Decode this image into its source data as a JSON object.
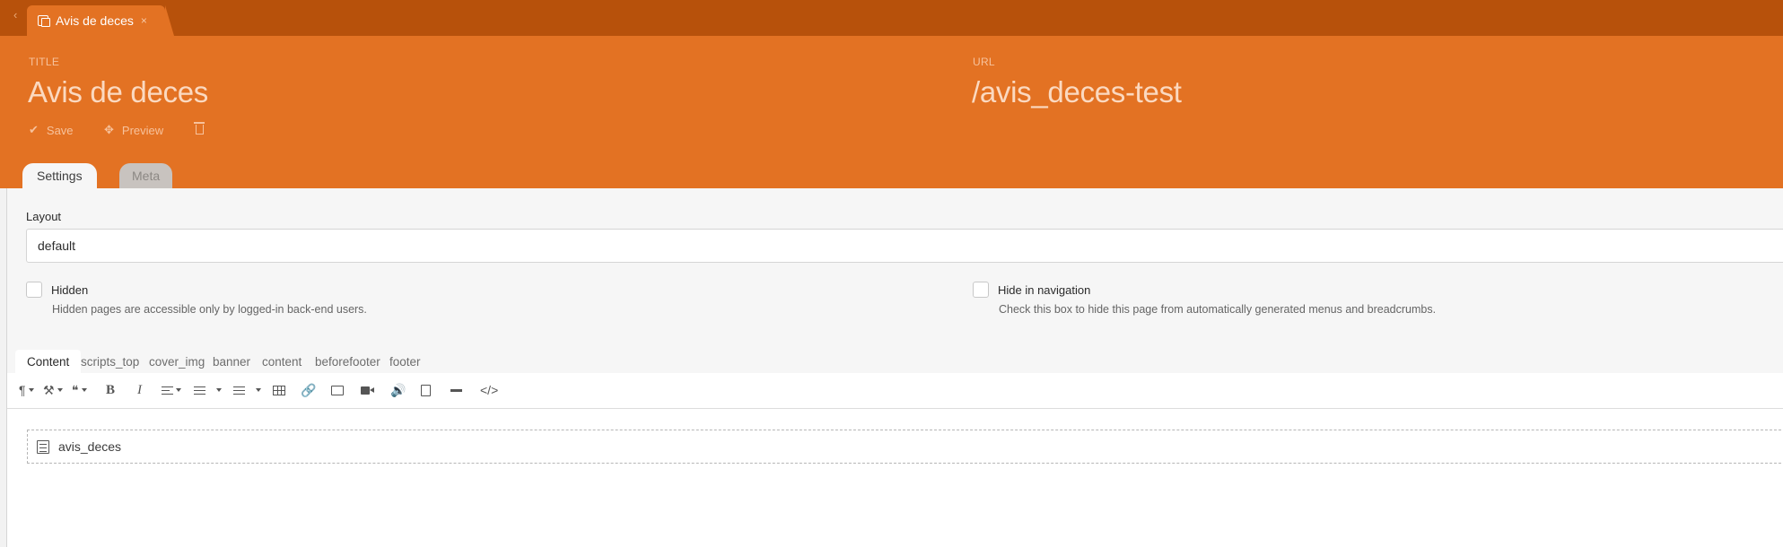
{
  "tab": {
    "title": "Avis de deces",
    "close": "×",
    "back": "‹"
  },
  "header": {
    "title_label": "TITLE",
    "title_value": "Avis de deces",
    "url_label": "URL",
    "url_value": "/avis_deces-test"
  },
  "actions": {
    "save": "Save",
    "preview": "Preview"
  },
  "form_tabs": {
    "settings": "Settings",
    "meta": "Meta"
  },
  "layout": {
    "label": "Layout",
    "value": "default"
  },
  "checkboxes": {
    "hidden": {
      "label": "Hidden",
      "help": "Hidden pages are accessible only by logged-in back-end users.",
      "checked": false
    },
    "hide_nav": {
      "label": "Hide in navigation",
      "help": "Check this box to hide this page from automatically generated menus and breadcrumbs.",
      "checked": false
    }
  },
  "content_tabs": [
    "Content",
    "scripts_top",
    "cover_img",
    "banner",
    "content",
    "beforefooter",
    "footer"
  ],
  "toolbar": {
    "paragraph": "¶",
    "quote": "❝",
    "bold": "B",
    "italic": "I",
    "link": "🔗",
    "audio": "🔊",
    "code": "</>",
    "icons": [
      "paragraph-format-icon",
      "magic-wand-icon",
      "quote-icon",
      "bold-icon",
      "italic-icon",
      "align-icon",
      "ordered-list-icon",
      "unordered-list-icon",
      "table-icon",
      "link-icon",
      "image-icon",
      "video-icon",
      "audio-icon",
      "file-icon",
      "horizontal-rule-icon",
      "code-view-icon"
    ]
  },
  "editor": {
    "snippet": "avis_deces"
  },
  "colors": {
    "header": "#e37223",
    "tabbar": "#b7510b",
    "panel": "#f6f6f6"
  }
}
